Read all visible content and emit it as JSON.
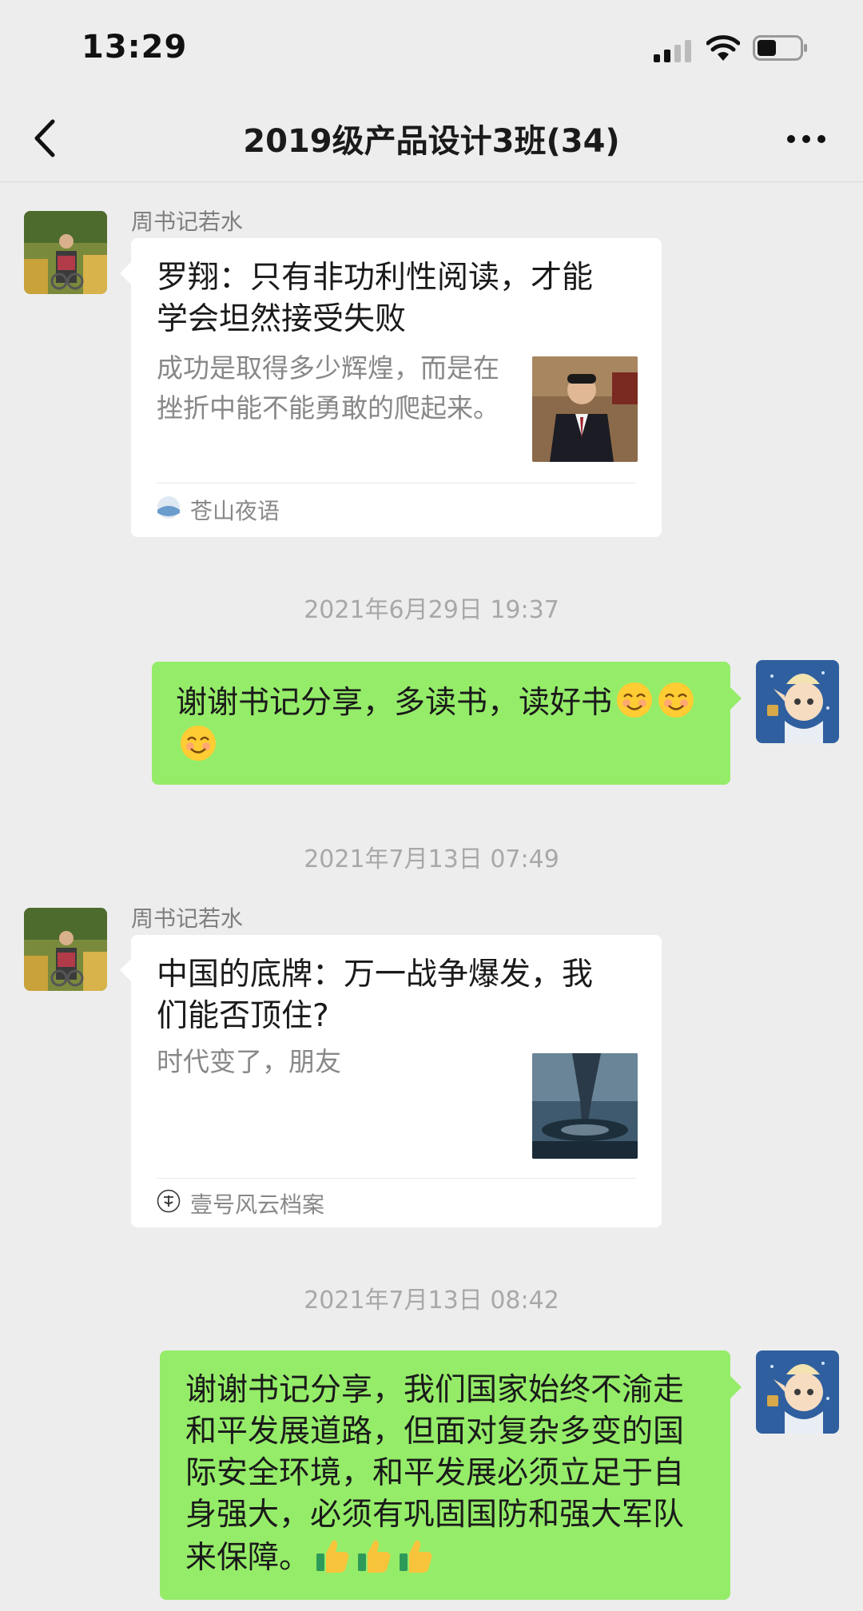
{
  "status_bar": {
    "time": "13:29",
    "battery_level": 0.45
  },
  "chat": {
    "title": "2019级产品设计3班(34)"
  },
  "messages": [
    {
      "type": "article",
      "sender": "周书记若水",
      "title": "罗翔：只有非功利性阅读，才能学会坦然接受失败",
      "description": "成功是取得多少辉煌，而是在挫折中能不能勇敢的爬起来。",
      "source": "苍山夜语"
    },
    {
      "type": "timestamp",
      "text": "2021年6月29日 19:37"
    },
    {
      "type": "text",
      "sender": "me",
      "text": "谢谢书记分享，多读书，读好书",
      "emoji": "smiling-face",
      "emoji_count": 3
    },
    {
      "type": "timestamp",
      "text": "2021年7月13日 07:49"
    },
    {
      "type": "article",
      "sender": "周书记若水",
      "title": "中国的底牌：万一战争爆发，我们能否顶住?",
      "description": "时代变了，朋友",
      "source": "壹号风云档案"
    },
    {
      "type": "timestamp",
      "text": "2021年7月13日 08:42"
    },
    {
      "type": "text",
      "sender": "me",
      "text": "谢谢书记分享，我们国家始终不渝走和平发展道路，但面对复杂多变的国际安全环境，和平发展必须立足于自身强大，必须有巩固国防和强大军队来保障。",
      "emoji": "thumbs-up",
      "emoji_count": 3
    }
  ],
  "colors": {
    "background": "#ededed",
    "my_bubble": "#95ec69",
    "card": "#ffffff",
    "secondary_text": "#888888"
  }
}
